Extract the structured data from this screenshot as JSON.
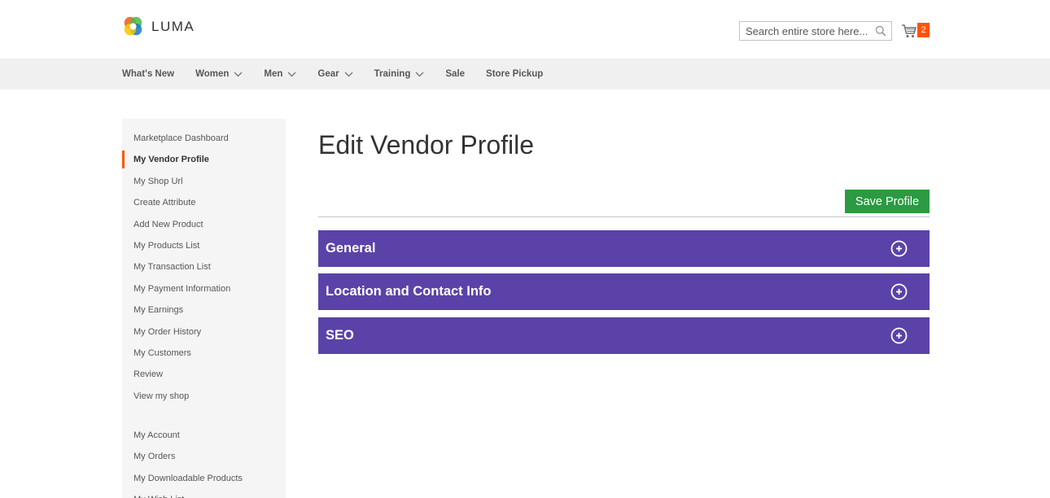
{
  "header": {
    "logo_text": "LUMA",
    "search_placeholder": "Search entire store here...",
    "cart_count": "2"
  },
  "nav": {
    "items": [
      {
        "label": "What's New",
        "has_dropdown": false
      },
      {
        "label": "Women",
        "has_dropdown": true
      },
      {
        "label": "Men",
        "has_dropdown": true
      },
      {
        "label": "Gear",
        "has_dropdown": true
      },
      {
        "label": "Training",
        "has_dropdown": true
      },
      {
        "label": "Sale",
        "has_dropdown": false
      },
      {
        "label": "Store Pickup",
        "has_dropdown": false
      }
    ]
  },
  "sidebar": {
    "vendor_items": [
      "Marketplace Dashboard",
      "My Vendor Profile",
      "My Shop Url",
      "Create Attribute",
      "Add New Product",
      "My Products List",
      "My Transaction List",
      "My Payment Information",
      "My Earnings",
      "My Order History",
      "My Customers",
      "Review",
      "View my shop"
    ],
    "active_item": "My Vendor Profile",
    "account_items": [
      "My Account",
      "My Orders",
      "My Downloadable Products",
      "My Wish List"
    ]
  },
  "main": {
    "title": "Edit Vendor Profile",
    "save_label": "Save Profile",
    "sections": [
      "General",
      "Location and Contact Info",
      "SEO"
    ]
  },
  "colors": {
    "accent": "#ff5501",
    "section_bg": "#5b42a8",
    "save_bg": "#2b9a42",
    "nav_bg": "#f0f0f0",
    "sidebar_bg": "#f5f5f5"
  }
}
